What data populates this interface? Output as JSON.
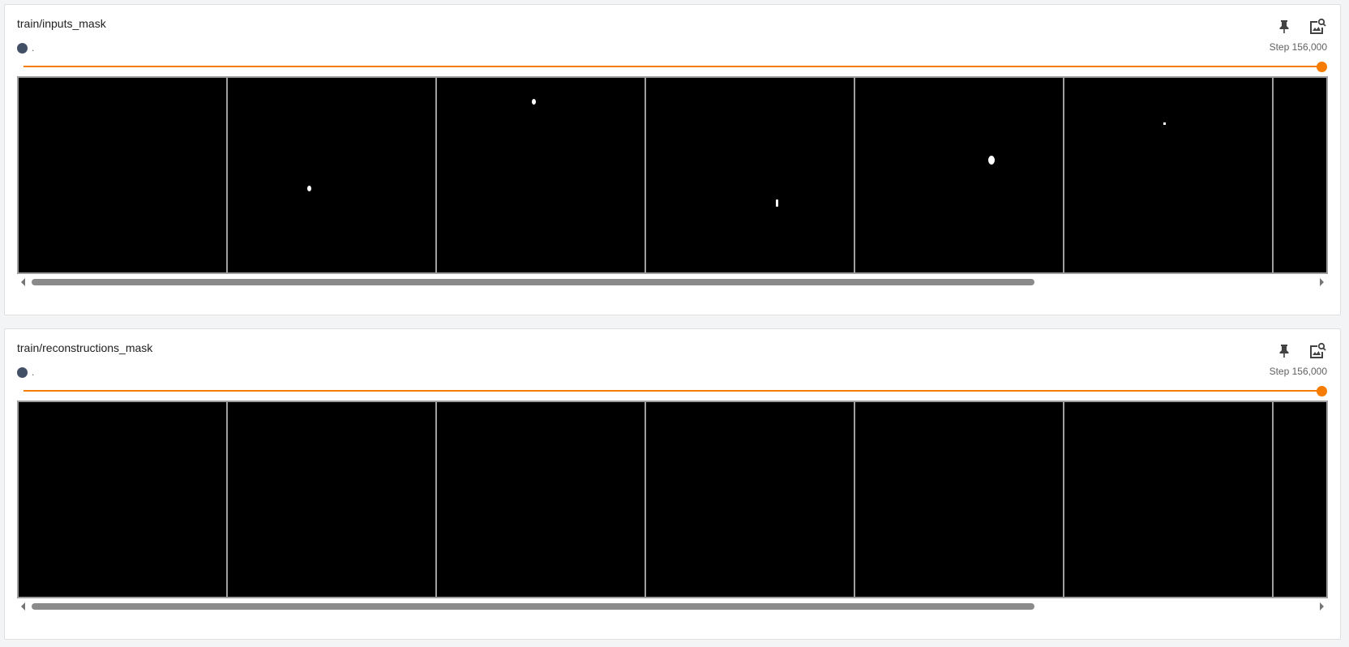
{
  "cards": [
    {
      "title": "train/inputs_mask",
      "run_label": ".",
      "step_label": "Step 156,000",
      "step_slider_fraction": 1.0,
      "accent_color": "#f57c00",
      "run_color": "#425066",
      "icons": [
        "pin-icon",
        "image-zoom-icon"
      ]
    },
    {
      "title": "train/reconstructions_mask",
      "run_label": ".",
      "step_label": "Step 156,000",
      "step_slider_fraction": 1.0,
      "accent_color": "#f57c00",
      "run_color": "#425066",
      "icons": [
        "pin-icon",
        "image-zoom-icon"
      ]
    }
  ]
}
